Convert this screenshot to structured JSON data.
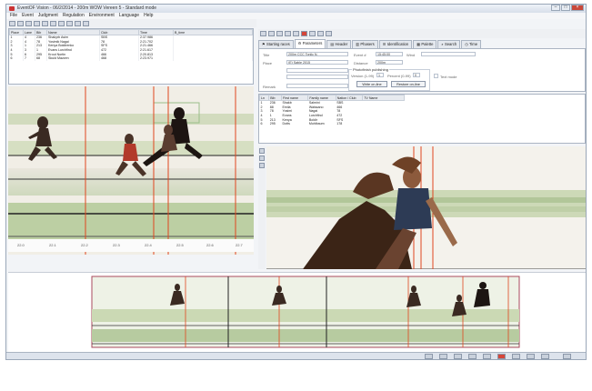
{
  "window": {
    "title": "EventOF Vision - 06/2/2014 - 200m WOW Vereen 5 - Standard mode"
  },
  "menu": [
    "File",
    "Event",
    "Judgment",
    "Regulation",
    "Environment",
    "Language",
    "Help"
  ],
  "toolbar_icons": [
    "new-icon",
    "open-icon",
    "save-icon",
    "print-icon",
    "copy-icon",
    "cut-icon",
    "paste-icon",
    "undo-icon",
    "zoom-icon",
    "camera-icon"
  ],
  "results": {
    "headers": [
      "Place",
      "Lane",
      "Bib",
      "Name",
      "Club",
      "Time",
      "B_time"
    ],
    "rows": [
      {
        "place": "1",
        "lane": "4",
        "bib": "236",
        "name": "Shakyrb Asim",
        "club": "SBS",
        "time": "2:37.986"
      },
      {
        "place": "2",
        "lane": "4",
        "bib": "78",
        "name": "Yosimik Nagai",
        "club": "78",
        "time": "2:21.702"
      },
      {
        "place": "3",
        "lane": "1",
        "bib": "213",
        "name": "Kenya Boldirenko",
        "club": "SFS",
        "time": "2:21.466"
      },
      {
        "place": "4",
        "lane": "3",
        "bib": "1",
        "name": "Evans Lurchfind",
        "club": "472",
        "time": "2:21.617"
      },
      {
        "place": "5",
        "lane": "6",
        "bib": "295",
        "name": "Krout Nortin",
        "club": "466",
        "time": "2:20.813"
      },
      {
        "place": "6",
        "lane": "7",
        "bib": "68",
        "name": "Skuld Mazzen",
        "club": "468",
        "time": "2:23.971"
      }
    ]
  },
  "time_axis": [
    "22.0",
    "22.1",
    "22.2",
    "22.3",
    "22.4",
    "22.5",
    "22.6",
    "22.7"
  ],
  "tabs": [
    {
      "label": "Starting races",
      "icon": "flag-icon"
    },
    {
      "label": "Parameters",
      "icon": "settings-icon",
      "active": true
    },
    {
      "label": "Header",
      "icon": "document-icon"
    },
    {
      "label": "Phasers",
      "icon": "chart-icon"
    },
    {
      "label": "Identification",
      "icon": "id-icon"
    },
    {
      "label": "Palette",
      "icon": "palette-icon"
    },
    {
      "label": "Search",
      "icon": "search-icon"
    },
    {
      "label": "Time",
      "icon": "clock-icon"
    }
  ],
  "params": {
    "title_label": "Title",
    "title_value": "200m CCC Tonlic N.",
    "place_label": "Place",
    "place_value": "(E) Sable 2015",
    "remark_label": "Remark",
    "remark_value": "",
    "distance_label": "Distance",
    "distance_value": "200m",
    "event_label": "Event #",
    "event_value": "15:45:00",
    "wind_label": "Wind",
    "wind_value": "",
    "publish_group": "Photofinish publishing",
    "version_label": "Version (1-99)",
    "version_value": "1",
    "percent_label": "Percent (0-99)",
    "percent_value": "0",
    "textmode_label": "Text mode",
    "write_btn": "Write on-line",
    "restore_btn": "Restore on-line"
  },
  "athletes": {
    "headers": [
      "Ln",
      "Bib",
      "First name",
      "Family name",
      "Nation / Club",
      "TV Name"
    ],
    "rows": [
      {
        "ln": "1",
        "bib": "236",
        "first": "Shakb",
        "family": "Salmini",
        "club": "SBS"
      },
      {
        "ln": "2",
        "bib": "88",
        "first": "Emila",
        "family": "Waissano",
        "club": "466"
      },
      {
        "ln": "3",
        "bib": "78",
        "first": "Yosimi",
        "family": "Nagai",
        "club": "78"
      },
      {
        "ln": "4",
        "bib": "1",
        "first": "Evans",
        "family": "Lurchfind",
        "club": "472"
      },
      {
        "ln": "5",
        "bib": "213",
        "first": "Kenya",
        "family": "Boldir",
        "club": "SFS"
      },
      {
        "ln": "6",
        "bib": "295",
        "first": "Dotts",
        "family": "Muhlbaum",
        "club": "178"
      }
    ]
  },
  "side_tool_icons": [
    "cursor-icon",
    "magnify-icon",
    "hand-icon"
  ],
  "status_icons": [
    "search-icon",
    "zoom-in-icon",
    "zoom-out-icon",
    "left-icon",
    "right-icon",
    "record-icon",
    "brush-icon",
    "grid-icon",
    "info-icon",
    "lock-icon"
  ],
  "colors": {
    "accent": "#d5463a",
    "finish_line": "#e0451f",
    "track_green": "#b8c9a0",
    "panel_bg": "#f2f4f7"
  }
}
